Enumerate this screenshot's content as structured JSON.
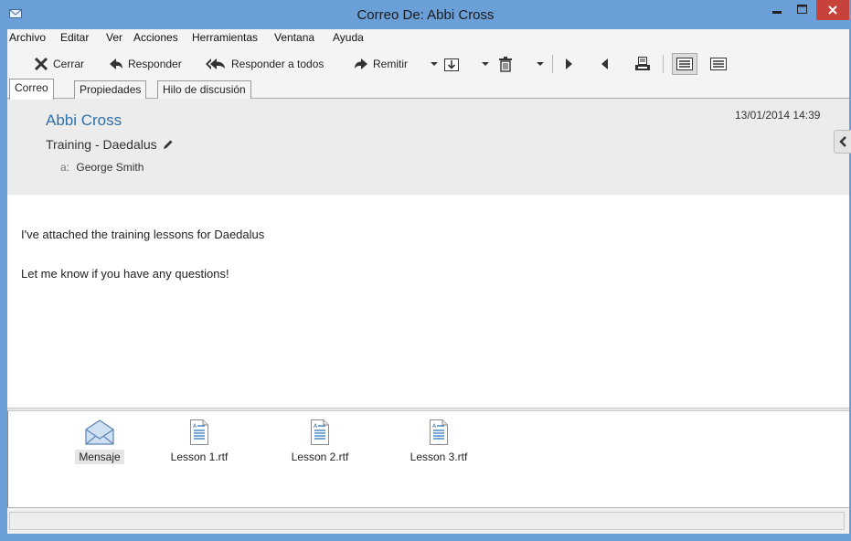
{
  "window": {
    "title": "Correo De: Abbi Cross"
  },
  "menu": [
    "Archivo",
    "Editar",
    "Ver",
    "Acciones",
    "Herramientas",
    "Ventana",
    "Ayuda"
  ],
  "toolbar": {
    "close_label": "Cerrar",
    "reply_label": "Responder",
    "reply_all_label": "Responder a todos",
    "forward_label": "Remitir"
  },
  "tabs": [
    "Correo",
    "Propiedades",
    "Hilo de discusión"
  ],
  "header": {
    "sender": "Abbi Cross",
    "subject": "Training - Daedalus",
    "to_label": "a:",
    "to": "George Smith",
    "date": "13/01/2014 14:39"
  },
  "message": {
    "lines": [
      "I've attached the training lessons for Daedalus",
      "Let me know if you have any questions!"
    ]
  },
  "attachments": [
    {
      "name": "Mensaje",
      "icon": "envelope-icon",
      "selected": true
    },
    {
      "name": "Lesson 1.rtf",
      "icon": "rtf-document-icon"
    },
    {
      "name": "Lesson 2.rtf",
      "icon": "rtf-document-icon"
    },
    {
      "name": "Lesson 3.rtf",
      "icon": "rtf-document-icon"
    }
  ],
  "colors": {
    "titlebar": "#6b9fd8",
    "close_button": "#c7423a",
    "sender": "#2f6fa8"
  }
}
